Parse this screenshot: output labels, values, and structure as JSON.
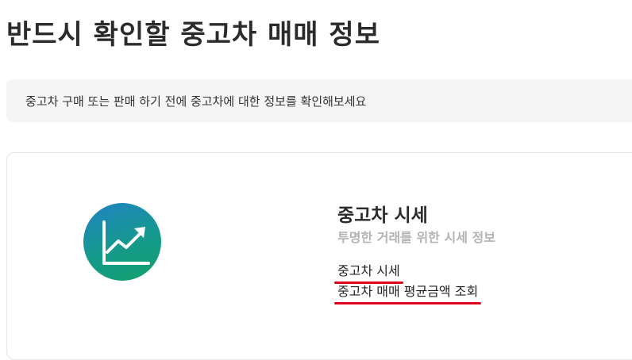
{
  "page": {
    "title": "반드시 확인할 중고차 매매 정보"
  },
  "notice": {
    "text": "중고차 구매 또는 판매 하기 전에 중고차에 대한 정보를 확인해보세요"
  },
  "card": {
    "icon": "trending-up-chart-icon",
    "title": "중고차 시세",
    "subtitle": "투명한 거래를 위한 시세 정보",
    "links": [
      {
        "label": "중고차 시세"
      },
      {
        "label": "중고차 매매 평균금액 조회"
      }
    ]
  },
  "colors": {
    "icon_gradient_start": "#1f82c4",
    "icon_gradient_end": "#12a06a",
    "highlight_underline": "#e0001b",
    "notice_background": "#f5f5f5"
  }
}
